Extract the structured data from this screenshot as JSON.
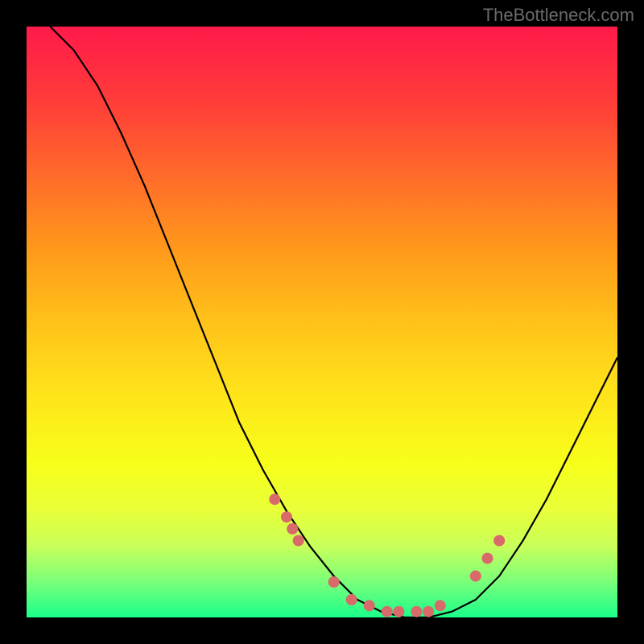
{
  "watermark": "TheBottleneck.com",
  "chart_data": {
    "type": "line",
    "title": "",
    "xlabel": "",
    "ylabel": "",
    "xlim": [
      0,
      100
    ],
    "ylim": [
      0,
      100
    ],
    "curve": {
      "name": "bottleneck-curve",
      "x": [
        4,
        8,
        12,
        16,
        20,
        24,
        28,
        32,
        36,
        40,
        44,
        48,
        52,
        56,
        60,
        64,
        68,
        72,
        76,
        80,
        84,
        88,
        92,
        96,
        100
      ],
      "y": [
        100,
        96,
        90,
        82,
        73,
        63,
        53,
        43,
        33,
        25,
        18,
        12,
        7,
        3,
        1,
        0,
        0,
        1,
        3,
        7,
        13,
        20,
        28,
        36,
        44
      ]
    },
    "markers": {
      "name": "highlight-points",
      "color": "#d86a6a",
      "x": [
        42,
        44,
        45,
        46,
        52,
        55,
        58,
        61,
        63,
        66,
        68,
        70,
        76,
        78,
        80
      ],
      "y": [
        20,
        17,
        15,
        13,
        6,
        3,
        2,
        1,
        1,
        1,
        1,
        2,
        7,
        10,
        13
      ]
    },
    "gradient_bands": [
      {
        "color": "#ff1a4a",
        "stop": 0
      },
      {
        "color": "#ffe31a",
        "stop": 62
      },
      {
        "color": "#1aff8a",
        "stop": 100
      }
    ]
  }
}
